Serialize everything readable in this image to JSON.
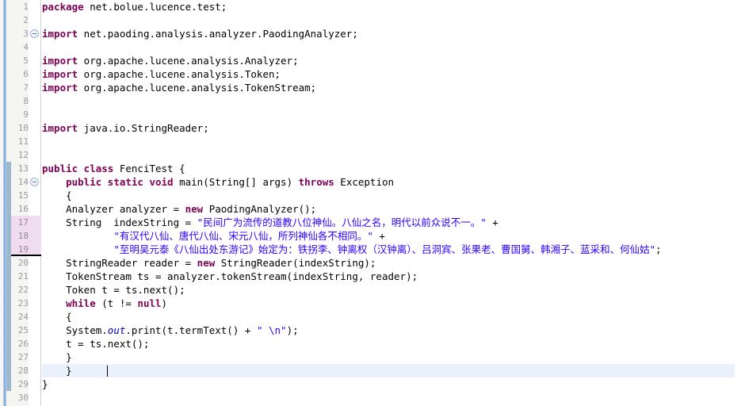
{
  "editor": {
    "name": "java-source-editor",
    "language": "Java",
    "font_size_px": 12.5,
    "line_height_px": 17,
    "colors": {
      "background": "#ffffff",
      "gutter_background": "#f5f5f3",
      "gutter_separator": "#d4d0c8",
      "line_number": "#9a9a9a",
      "keyword": "#7f0055",
      "string": "#2a00ff",
      "field_italic": "#0000c0",
      "plain_text": "#000000",
      "current_line_highlight": "#e9f2fc",
      "changed_line_highlight": "#f0dcf0",
      "annotation_hatch": "#3a78c2",
      "annotation_ruler": "#7ba7d7"
    },
    "cursor": {
      "line": 28,
      "column": 10
    },
    "current_line": 28,
    "changed_lines": [
      17,
      18,
      19
    ],
    "changed_block_underline_after_line": 19,
    "hatched_block_start_line": 13,
    "hatched_block_end_line": 29,
    "fold_markers": [
      {
        "line": 3,
        "icon": "fold-collapse-icon",
        "state": "expanded"
      },
      {
        "line": 14,
        "icon": "fold-collapse-icon",
        "state": "expanded"
      }
    ]
  },
  "lines": [
    {
      "n": 1,
      "tokens": [
        {
          "t": "package",
          "c": "kw"
        },
        {
          "t": " net.bolue.lucence.test;",
          "c": "plain"
        }
      ]
    },
    {
      "n": 2,
      "tokens": []
    },
    {
      "n": 3,
      "tokens": [
        {
          "t": "import",
          "c": "kw"
        },
        {
          "t": " net.paoding.analysis.analyzer.PaodingAnalyzer;",
          "c": "plain"
        }
      ]
    },
    {
      "n": 4,
      "tokens": []
    },
    {
      "n": 5,
      "tokens": [
        {
          "t": "import",
          "c": "kw"
        },
        {
          "t": " org.apache.lucene.analysis.Analyzer;",
          "c": "plain"
        }
      ]
    },
    {
      "n": 6,
      "tokens": [
        {
          "t": "import",
          "c": "kw"
        },
        {
          "t": " org.apache.lucene.analysis.Token;",
          "c": "plain"
        }
      ]
    },
    {
      "n": 7,
      "tokens": [
        {
          "t": "import",
          "c": "kw"
        },
        {
          "t": " org.apache.lucene.analysis.TokenStream;",
          "c": "plain"
        }
      ]
    },
    {
      "n": 8,
      "tokens": []
    },
    {
      "n": 9,
      "tokens": []
    },
    {
      "n": 10,
      "tokens": [
        {
          "t": "import",
          "c": "kw"
        },
        {
          "t": " java.io.StringReader;",
          "c": "plain"
        }
      ]
    },
    {
      "n": 11,
      "tokens": []
    },
    {
      "n": 12,
      "tokens": []
    },
    {
      "n": 13,
      "tokens": [
        {
          "t": "public class",
          "c": "kw"
        },
        {
          "t": " FenciTest {",
          "c": "plain"
        }
      ]
    },
    {
      "n": 14,
      "tokens": [
        {
          "t": "    ",
          "c": "plain"
        },
        {
          "t": "public static void",
          "c": "kw"
        },
        {
          "t": " main(String[] args) ",
          "c": "plain"
        },
        {
          "t": "throws",
          "c": "kw"
        },
        {
          "t": " Exception",
          "c": "plain"
        }
      ]
    },
    {
      "n": 15,
      "tokens": [
        {
          "t": "    {",
          "c": "plain"
        }
      ]
    },
    {
      "n": 16,
      "tokens": [
        {
          "t": "    Analyzer analyzer = ",
          "c": "plain"
        },
        {
          "t": "new",
          "c": "kw"
        },
        {
          "t": " PaodingAnalyzer();",
          "c": "plain"
        }
      ]
    },
    {
      "n": 17,
      "tokens": [
        {
          "t": "    String  indexString = ",
          "c": "plain"
        },
        {
          "t": "\"",
          "c": "str"
        },
        {
          "t": "民间广为流传的道教八位神仙。八仙之名，明代以前众说不一。",
          "c": "cjk"
        },
        {
          "t": "\"",
          "c": "str"
        },
        {
          "t": " +",
          "c": "plain"
        }
      ]
    },
    {
      "n": 18,
      "tokens": [
        {
          "t": "            ",
          "c": "plain"
        },
        {
          "t": "\"",
          "c": "str"
        },
        {
          "t": "有汉代八仙、唐代八仙、宋元八仙，所列神仙各不相同。",
          "c": "cjk"
        },
        {
          "t": "\"",
          "c": "str"
        },
        {
          "t": " +",
          "c": "plain"
        }
      ]
    },
    {
      "n": 19,
      "tokens": [
        {
          "t": "            ",
          "c": "plain"
        },
        {
          "t": "\"",
          "c": "str"
        },
        {
          "t": "至明吴元泰《八仙出处东游记》始定为：铁拐李、钟离权（汉钟离）、吕洞宾、张果老、曹国舅、韩湘子、蓝采和、何仙姑",
          "c": "cjk"
        },
        {
          "t": "\"",
          "c": "str"
        },
        {
          "t": ";",
          "c": "plain"
        }
      ]
    },
    {
      "n": 20,
      "tokens": [
        {
          "t": "    StringReader reader = ",
          "c": "plain"
        },
        {
          "t": "new",
          "c": "kw"
        },
        {
          "t": " StringReader(indexString);",
          "c": "plain"
        }
      ]
    },
    {
      "n": 21,
      "tokens": [
        {
          "t": "    TokenStream ts = analyzer.tokenStream(indexString, reader);",
          "c": "plain"
        }
      ]
    },
    {
      "n": 22,
      "tokens": [
        {
          "t": "    Token t = ts.next();",
          "c": "plain"
        }
      ]
    },
    {
      "n": 23,
      "tokens": [
        {
          "t": "    ",
          "c": "plain"
        },
        {
          "t": "while",
          "c": "kw"
        },
        {
          "t": " (t != ",
          "c": "plain"
        },
        {
          "t": "null",
          "c": "kw"
        },
        {
          "t": ")",
          "c": "plain"
        }
      ]
    },
    {
      "n": 24,
      "tokens": [
        {
          "t": "    {",
          "c": "plain"
        }
      ]
    },
    {
      "n": 25,
      "tokens": [
        {
          "t": "    System.",
          "c": "plain"
        },
        {
          "t": "out",
          "c": "fld"
        },
        {
          "t": ".print(t.termText() + ",
          "c": "plain"
        },
        {
          "t": "\" \\n\"",
          "c": "str"
        },
        {
          "t": ");",
          "c": "plain"
        }
      ]
    },
    {
      "n": 26,
      "tokens": [
        {
          "t": "    t = ts.next();",
          "c": "plain"
        }
      ]
    },
    {
      "n": 27,
      "tokens": [
        {
          "t": "    }",
          "c": "plain"
        }
      ]
    },
    {
      "n": 28,
      "tokens": [
        {
          "t": "    }",
          "c": "plain"
        }
      ]
    },
    {
      "n": 29,
      "tokens": [
        {
          "t": "}",
          "c": "plain"
        }
      ]
    },
    {
      "n": 30,
      "tokens": []
    }
  ]
}
